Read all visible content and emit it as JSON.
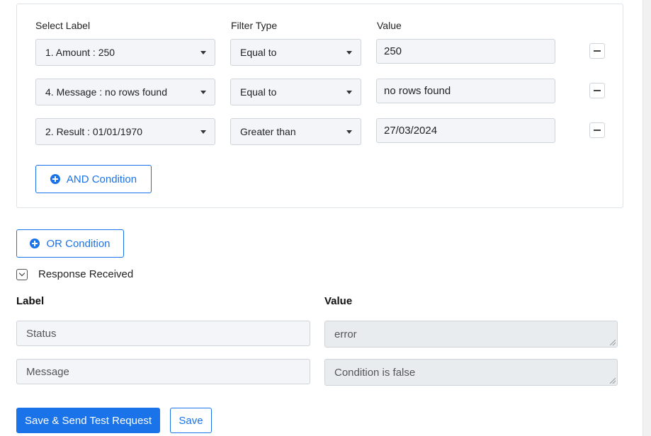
{
  "filter": {
    "headers": {
      "select_label": "Select Label",
      "filter_type": "Filter Type",
      "value": "Value"
    },
    "rows": [
      {
        "label": "1. Amount : 250",
        "filter_type": "Equal to",
        "value": "250"
      },
      {
        "label": "4. Message : no rows found",
        "filter_type": "Equal to",
        "value": "no rows found"
      },
      {
        "label": "2. Result : 01/01/1970",
        "filter_type": "Greater than",
        "value": "27/03/2024"
      }
    ],
    "and_condition_label": "AND Condition"
  },
  "or_condition_label": "OR Condition",
  "response": {
    "title": "Response Received",
    "label_header": "Label",
    "value_header": "Value",
    "rows": [
      {
        "label": "Status",
        "value": "error"
      },
      {
        "label": "Message",
        "value": "Condition is false"
      }
    ]
  },
  "actions": {
    "save_send_label": "Save & Send Test Request",
    "save_label": "Save"
  },
  "colors": {
    "accent": "#1a73e8",
    "input_bg": "#f3f5f8",
    "readonly_bg": "#e9ecef",
    "border": "#ced4da"
  }
}
